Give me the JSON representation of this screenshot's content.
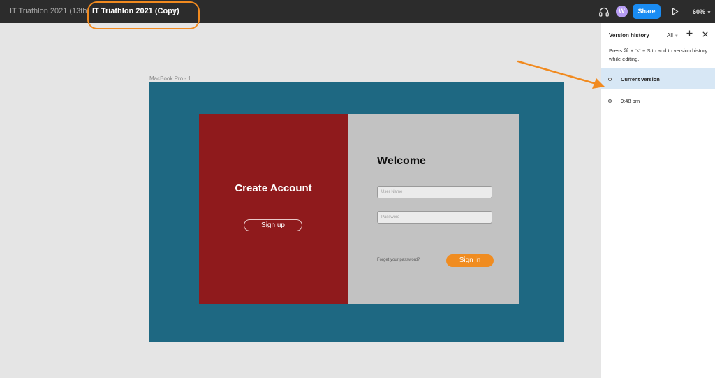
{
  "header": {
    "parent_file": "IT Triathlon 2021 (13th)",
    "separator": "/",
    "current_file": "IT Triathlon 2021 (Copy)",
    "avatar_initial": "W",
    "share_label": "Share",
    "zoom": "60%",
    "icons": [
      "headphones-icon",
      "play-icon",
      "chevron-down-icon"
    ]
  },
  "canvas": {
    "frame_label": "MacBook Pro - 1",
    "left_panel": {
      "title": "Create Account",
      "signup_label": "Sign up"
    },
    "right_panel": {
      "title": "Welcome",
      "username_placeholder": "User Name",
      "password_placeholder": "Password",
      "forgot_label": "Forget your password?",
      "signin_label": "Sign in"
    }
  },
  "version_history": {
    "title": "Version history",
    "filter": "All",
    "hint": "Press ⌘ + ⌥ + S to add to version history while editing.",
    "items": [
      {
        "label": "Current version",
        "selected": true
      },
      {
        "label": "9:48 pm",
        "selected": false
      }
    ]
  },
  "colors": {
    "topbar": "#2c2c2c",
    "accent_annotation": "#f18a1f",
    "share_button": "#1a8cf3",
    "frame_bg": "#1e6882",
    "left_panel": "#8f1a1c",
    "right_panel": "#c2c2c2",
    "signin_button": "#f08c20",
    "selected_row": "#d7e7f5"
  }
}
